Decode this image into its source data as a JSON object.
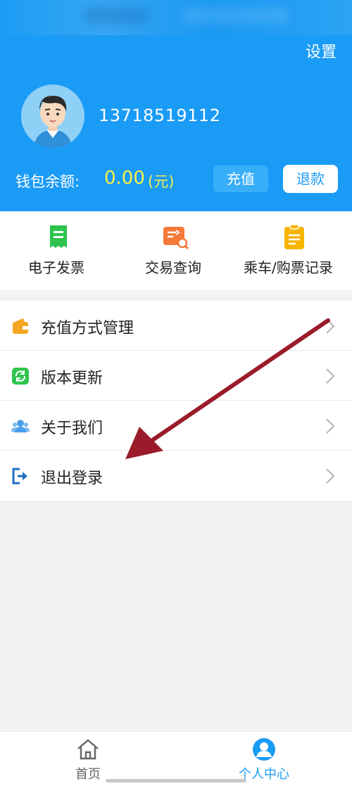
{
  "header": {
    "settings_label": "设置",
    "phone": "13718519112",
    "wallet_label": "钱包余额:",
    "wallet_amount": "0.00",
    "wallet_unit": "(元)",
    "recharge_label": "充值",
    "refund_label": "退款"
  },
  "quick_actions": [
    {
      "label": "电子发票",
      "icon": "receipt-icon",
      "color": "#2ec44e"
    },
    {
      "label": "交易查询",
      "icon": "transaction-search-icon",
      "color": "#f37a3a"
    },
    {
      "label": "乘车/购票记录",
      "icon": "clipboard-icon",
      "color": "#f7b500"
    }
  ],
  "menu": [
    {
      "label": "充值方式管理",
      "icon": "wallet-icon",
      "color": "#f5a623"
    },
    {
      "label": "版本更新",
      "icon": "refresh-icon",
      "color": "#2ec44e"
    },
    {
      "label": "关于我们",
      "icon": "users-icon",
      "color": "#4a9ee8"
    },
    {
      "label": "退出登录",
      "icon": "logout-icon",
      "color": "#1e6fc1"
    }
  ],
  "tabbar": {
    "home_label": "首页",
    "profile_label": "个人中心",
    "active_color": "#1a9bf6",
    "inactive_color": "#666666"
  },
  "colors": {
    "primary": "#1a9bf6",
    "amount": "#f8ee4a",
    "annotation_arrow": "#9b1b2a"
  }
}
